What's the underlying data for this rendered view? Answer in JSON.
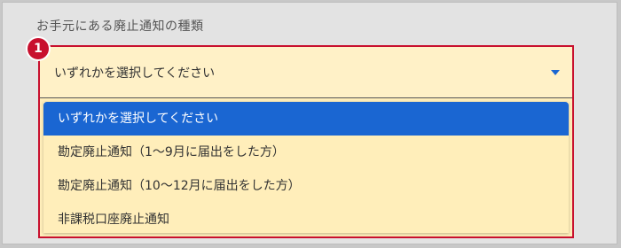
{
  "field": {
    "label": "お手元にある廃止通知の種類"
  },
  "select": {
    "value": "いずれかを選択してください",
    "options": [
      {
        "label": "いずれかを選択してください",
        "selected": true
      },
      {
        "label": "勘定廃止通知（1～9月に届出をした方）",
        "selected": false
      },
      {
        "label": "勘定廃止通知（10～12月に届出をした方）",
        "selected": false
      },
      {
        "label": "非課税口座廃止通知",
        "selected": false
      }
    ]
  },
  "annotation": {
    "marker": "1"
  },
  "colors": {
    "highlight": "#c8102e",
    "dropdown_bg": "#ffeeba",
    "selected_bg": "#1a66d2",
    "caret": "#1a66d2"
  },
  "icons": {
    "caret": "caret-down-icon"
  }
}
